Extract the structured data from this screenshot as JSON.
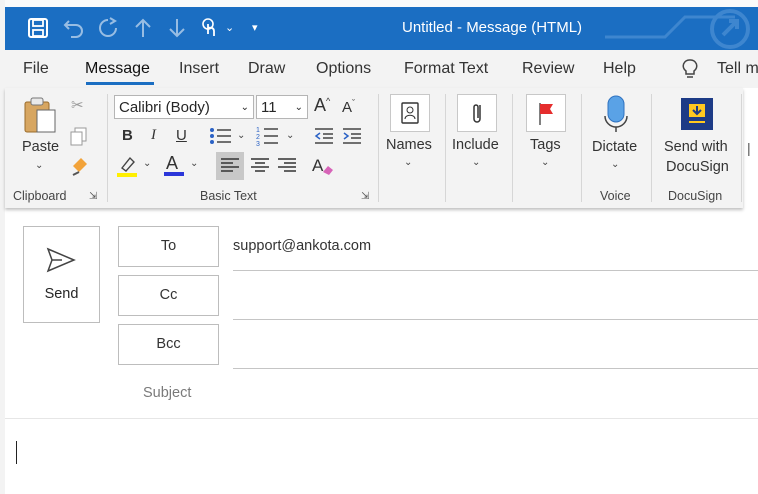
{
  "window": {
    "title": "Untitled  -  Message (HTML)"
  },
  "menu": {
    "tabs": [
      "File",
      "Message",
      "Insert",
      "Draw",
      "Options",
      "Format Text",
      "Review",
      "Help"
    ],
    "tell_me": "Tell m"
  },
  "ribbon": {
    "clipboard": {
      "paste": "Paste",
      "group": "Clipboard"
    },
    "basic_text": {
      "font": "Calibri (Body)",
      "size": "11",
      "bold": "B",
      "italic": "I",
      "underline": "U",
      "grow": "A",
      "shrink": "A",
      "highlight_color": "#ffef00",
      "font_color": "#2b36d9",
      "group": "Basic Text"
    },
    "names": {
      "label": "Names"
    },
    "include": {
      "label": "Include"
    },
    "tags": {
      "label": "Tags"
    },
    "voice": {
      "label": "Dictate",
      "group": "Voice"
    },
    "docusign": {
      "label_line1": "Send with",
      "label_line2": "DocuSign",
      "group": "DocuSign"
    }
  },
  "compose": {
    "send": "Send",
    "to_label": "To",
    "cc_label": "Cc",
    "bcc_label": "Bcc",
    "subject_label": "Subject",
    "to_value": "support@ankota.com"
  }
}
